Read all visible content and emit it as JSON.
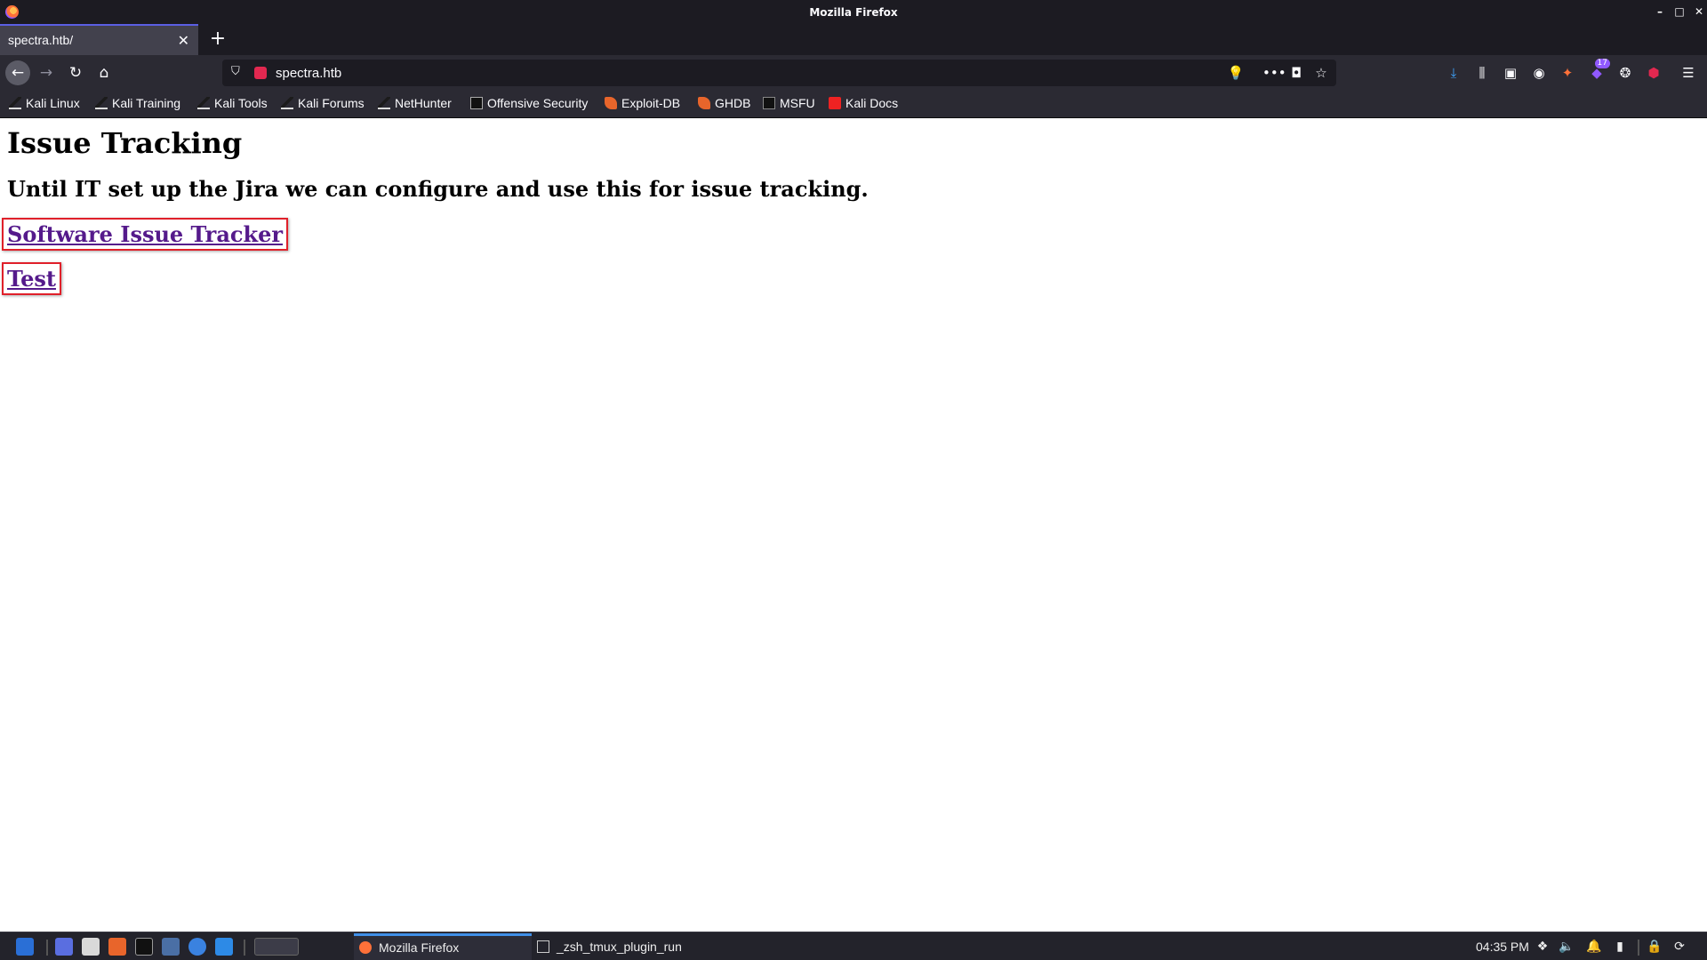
{
  "window": {
    "title": "Mozilla Firefox"
  },
  "tabs": [
    {
      "label": "spectra.htb/"
    }
  ],
  "address_bar": {
    "url": "spectra.htb"
  },
  "toolbar": {
    "extension_badge": "17"
  },
  "bookmarks": [
    {
      "label": "Kali Linux",
      "icon": "kali-dragon-icon"
    },
    {
      "label": "Kali Training",
      "icon": "kali-dragon-icon"
    },
    {
      "label": "Kali Tools",
      "icon": "kali-dragon-icon"
    },
    {
      "label": "Kali Forums",
      "icon": "kali-dragon-icon"
    },
    {
      "label": "NetHunter",
      "icon": "kali-dragon-icon"
    },
    {
      "label": "Offensive Security",
      "icon": "offsec-icon"
    },
    {
      "label": "Exploit-DB",
      "icon": "exploit-db-icon"
    },
    {
      "label": "GHDB",
      "icon": "exploit-db-icon"
    },
    {
      "label": "MSFU",
      "icon": "offsec-icon"
    },
    {
      "label": "Kali Docs",
      "icon": "kali-docs-icon"
    }
  ],
  "page": {
    "heading": "Issue Tracking",
    "subheading": "Until IT set up the Jira we can configure and use this for issue tracking.",
    "links": [
      {
        "label": "Software Issue Tracker"
      },
      {
        "label": "Test"
      }
    ]
  },
  "taskbar": {
    "windows": [
      {
        "label": "Mozilla Firefox",
        "active": true
      },
      {
        "label": "_zsh_tmux_plugin_run",
        "active": false
      }
    ],
    "clock": "04:35 PM"
  },
  "colors": {
    "chrome_dark": "#1c1b22",
    "toolbar": "#2b2a33",
    "link_visited": "#551a8b",
    "annotation_box": "#e0202a",
    "active_tab_accent": "#5b5fe3"
  }
}
